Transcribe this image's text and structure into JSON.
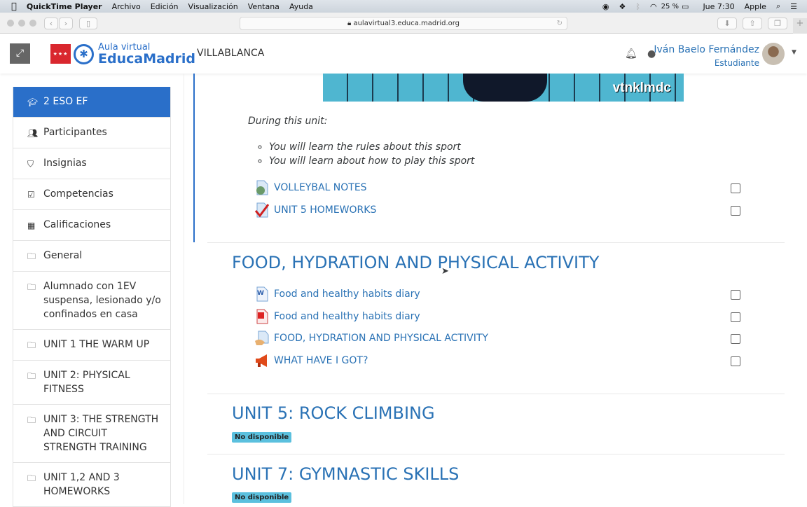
{
  "menubar": {
    "app": "QuickTime Player",
    "items": [
      "Archivo",
      "Edición",
      "Visualización",
      "Ventana",
      "Ayuda"
    ],
    "battery": "25 %",
    "clock": "Jue 7:30",
    "user": "Apple"
  },
  "browser": {
    "url": "aulavirtual3.educa.madrid.org"
  },
  "header": {
    "logo_top": "Aula virtual",
    "logo_bottom": "EducaMadrid",
    "site": "VILLABLANCA",
    "user_name": "Iván Baelo Fernández",
    "user_role": "Estudiante"
  },
  "sidebar": {
    "items": [
      {
        "label": "2 ESO EF",
        "icon": "graduation-cap-icon"
      },
      {
        "label": "Participantes",
        "icon": "users-icon"
      },
      {
        "label": "Insignias",
        "icon": "shield-icon"
      },
      {
        "label": "Competencias",
        "icon": "checkbox-icon"
      },
      {
        "label": "Calificaciones",
        "icon": "table-icon"
      },
      {
        "label": "General",
        "icon": "folder-icon"
      },
      {
        "label": "Alumnado con 1EV suspensa, lesionado y/o confinados en casa",
        "icon": "folder-icon"
      },
      {
        "label": "UNIT 1 THE WARM UP",
        "icon": "folder-icon"
      },
      {
        "label": "UNIT 2: PHYSICAL FITNESS",
        "icon": "folder-icon"
      },
      {
        "label": "UNIT 3: THE STRENGTH AND CIRCUIT STRENGTH TRAINING",
        "icon": "folder-icon"
      },
      {
        "label": "UNIT 1,2 AND 3 HOMEWORKS",
        "icon": "folder-icon"
      }
    ]
  },
  "main": {
    "banner_text": "vtnklmdc",
    "intro": "During this unit:",
    "bullets": [
      "You will learn the rules about this sport",
      "You will learn about how to play this sport"
    ],
    "volley_activities": [
      {
        "label": "VOLLEYBAL NOTES",
        "icon": "url-icon"
      },
      {
        "label": "UNIT 5 HOMEWORKS",
        "icon": "assignment-icon"
      }
    ],
    "food_title": "FOOD, HYDRATION AND PHYSICAL ACTIVITY",
    "food_activities": [
      {
        "label": "Food and healthy habits diary",
        "icon": "word-icon"
      },
      {
        "label": "Food and healthy habits diary",
        "icon": "pdf-icon"
      },
      {
        "label": "FOOD, HYDRATION AND PHYSICAL ACTIVITY",
        "icon": "page-icon"
      },
      {
        "label": "WHAT HAVE I GOT?",
        "icon": "feedback-icon"
      }
    ],
    "unit5_title": "UNIT 5: ROCK CLIMBING",
    "unit7_title": "UNIT 7: GYMNASTIC SKILLS",
    "unavailable": "No disponible"
  }
}
